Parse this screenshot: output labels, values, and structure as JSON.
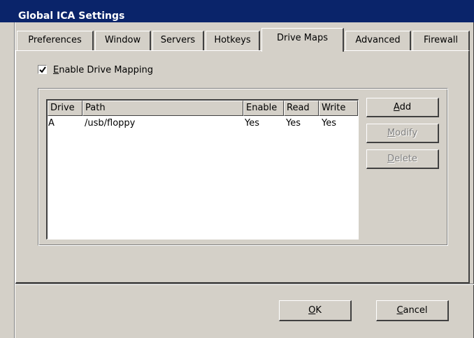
{
  "window": {
    "title": "Global ICA Settings"
  },
  "tabs": [
    {
      "label": "Preferences",
      "active": false
    },
    {
      "label": "Window",
      "active": false
    },
    {
      "label": "Servers",
      "active": false
    },
    {
      "label": "Hotkeys",
      "active": false
    },
    {
      "label": "Drive Maps",
      "active": true
    },
    {
      "label": "Advanced",
      "active": false
    },
    {
      "label": "Firewall",
      "active": false
    }
  ],
  "enable_mapping": {
    "mnemonic": "E",
    "rest": "nable Drive Mapping",
    "checked": true
  },
  "table": {
    "columns": [
      "Drive",
      "Path",
      "Enable",
      "Read",
      "Write"
    ],
    "rows": [
      {
        "drive": "A",
        "path": "/usb/floppy",
        "enable": "Yes",
        "read": "Yes",
        "write": "Yes"
      }
    ]
  },
  "side_buttons": {
    "add": {
      "mnemonic": "A",
      "rest": "dd",
      "enabled": true
    },
    "modify": {
      "mnemonic": "M",
      "rest": "odify",
      "enabled": false
    },
    "delete": {
      "mnemonic": "D",
      "rest": "elete",
      "enabled": false
    }
  },
  "dialog_buttons": {
    "ok": {
      "mnemonic": "O",
      "rest": "K"
    },
    "cancel": {
      "mnemonic": "C",
      "rest": "ancel"
    }
  }
}
